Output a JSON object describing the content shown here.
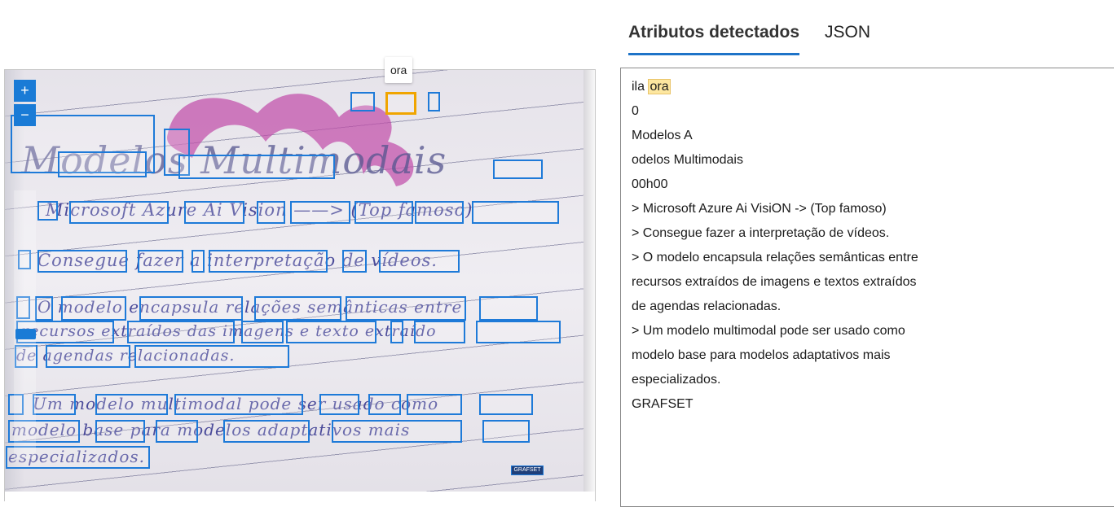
{
  "tabs": [
    {
      "label": "Atributos detectados",
      "active": true
    },
    {
      "label": "JSON",
      "active": false
    }
  ],
  "image_viewer": {
    "zoom_in_label": "+",
    "zoom_out_label": "−",
    "tooltip": "ora",
    "handwriting": [
      "Modelos Multimodais",
      "Microsoft Azure Ai Vision ——> (Top famoso)",
      "Consegue fazer a interpretação de vídeos.",
      "O modelo encapsula relações semânticas entre",
      "recursos extraídos das imagens e texto extraído",
      "de agendas relacionadas.",
      "Um modelo multimodal pode ser usado como",
      "modelo base para modelos adaptativos mais",
      "especializados."
    ],
    "logo_text": "GRAFSET",
    "accent_color": "#1e7ad8",
    "selected_color": "#f0a500"
  },
  "results": {
    "first_line_prefix": "ila",
    "first_line_highlight": "ora",
    "lines": [
      "0",
      "Modelos A",
      "odelos Multimodais",
      "00h00",
      "> Microsoft Azure Ai VisiON -> (Top famoso)",
      "> Consegue fazer a interpretação de vídeos.",
      "> O modelo encapsula relações semânticas entre",
      "recursos extraídos de imagens e textos extraídos",
      "de agendas relacionadas.",
      "> Um modelo multimodal pode ser usado como",
      "modelo base para modelos adaptativos mais",
      "especializados.",
      "GRAFSET"
    ]
  }
}
